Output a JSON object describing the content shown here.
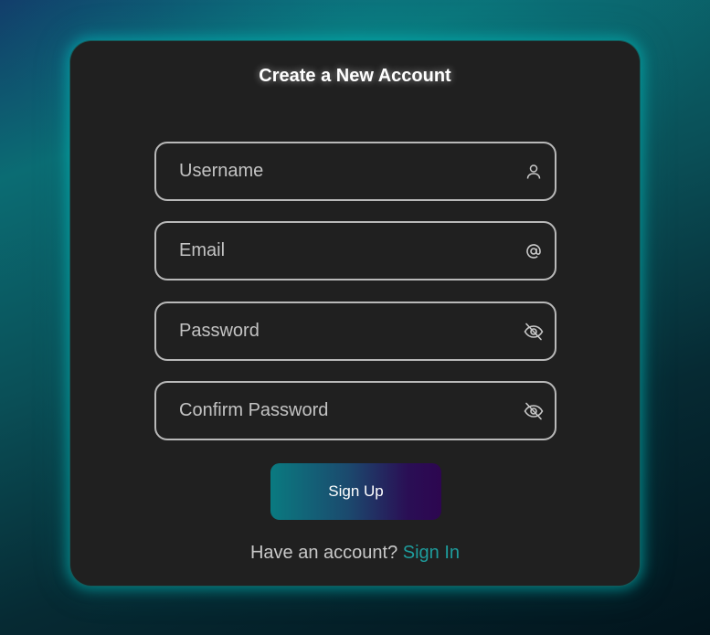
{
  "form": {
    "title": "Create a New Account",
    "fields": [
      {
        "placeholder": "Username",
        "icon": "user-icon"
      },
      {
        "placeholder": "Email",
        "icon": "at-sign-icon"
      },
      {
        "placeholder": "Password",
        "icon": "eye-slash-icon"
      },
      {
        "placeholder": "Confirm Password",
        "icon": "eye-slash-icon"
      }
    ],
    "submit_label": "Sign Up",
    "footer_text": "Have an account?",
    "footer_link": "Sign In"
  },
  "colors": {
    "card_background": "#202020",
    "accent_teal": "#1e9c9c",
    "button_gradient_start": "#0a7a80",
    "button_gradient_end": "#2d0650",
    "field_border": "#b9b9b9"
  }
}
